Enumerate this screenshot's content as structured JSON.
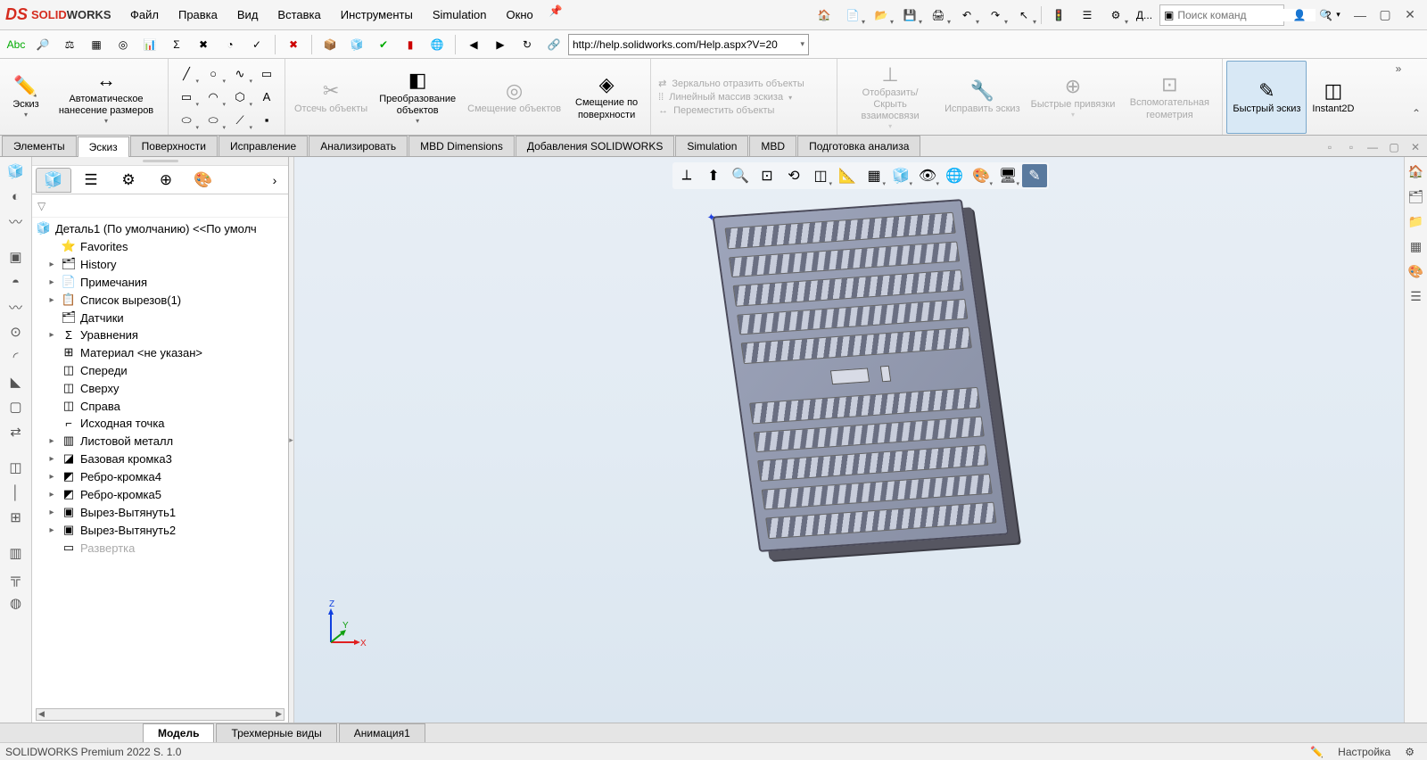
{
  "app": {
    "logo": "SOLIDWORKS"
  },
  "menu": {
    "items": [
      "Файл",
      "Правка",
      "Вид",
      "Вставка",
      "Инструменты",
      "Simulation",
      "Окно"
    ]
  },
  "search": {
    "placeholder": "Поиск команд"
  },
  "qat_last": "Д...",
  "toolbar2": {
    "url": "http://help.solidworks.com/Help.aspx?V=20"
  },
  "ribbon": {
    "sketch": "Эскиз",
    "smart_dim": "Автоматическое нанесение размеров",
    "trim": "Отсечь объекты",
    "convert": "Преобразование объектов",
    "offset": "Смещение объектов",
    "offset_surface": "Смещение по поверхности",
    "mirror": "Зеркально отразить объекты",
    "linear": "Линейный массив эскиза",
    "move": "Переместить объекты",
    "display": "Отобразить/Скрыть взаимосвязи",
    "repair": "Исправить эскиз",
    "quick_snaps": "Быстрые привязки",
    "construction_geom": "Вспомогательная геометрия",
    "rapid_sketch": "Быстрый эскиз",
    "instant2d": "Instant2D"
  },
  "cm_tabs": [
    "Элементы",
    "Эскиз",
    "Поверхности",
    "Исправление",
    "Анализировать",
    "MBD Dimensions",
    "Добавления SOLIDWORKS",
    "Simulation",
    "MBD",
    "Подготовка анализа"
  ],
  "cm_active": 1,
  "tree": {
    "root": "Деталь1 (По умолчанию) <<По умолч",
    "items": [
      {
        "icon": "⭐",
        "label": "Favorites",
        "caret": ""
      },
      {
        "icon": "🗂",
        "label": "History",
        "caret": "▸"
      },
      {
        "icon": "📄",
        "label": "Примечания",
        "caret": "▸"
      },
      {
        "icon": "📋",
        "label": "Список вырезов(1)",
        "caret": "▸"
      },
      {
        "icon": "🗂",
        "label": "Датчики",
        "caret": ""
      },
      {
        "icon": "Σ",
        "label": "Уравнения",
        "caret": "▸"
      },
      {
        "icon": "⊞",
        "label": "Материал <не указан>",
        "caret": ""
      },
      {
        "icon": "◫",
        "label": "Спереди",
        "caret": ""
      },
      {
        "icon": "◫",
        "label": "Сверху",
        "caret": ""
      },
      {
        "icon": "◫",
        "label": "Справа",
        "caret": ""
      },
      {
        "icon": "⌐",
        "label": "Исходная точка",
        "caret": ""
      },
      {
        "icon": "▥",
        "label": "Листовой металл",
        "caret": "▸"
      },
      {
        "icon": "◪",
        "label": "Базовая кромка3",
        "caret": "▸"
      },
      {
        "icon": "◩",
        "label": "Ребро-кромка4",
        "caret": "▸"
      },
      {
        "icon": "◩",
        "label": "Ребро-кромка5",
        "caret": "▸"
      },
      {
        "icon": "▣",
        "label": "Вырез-Вытянуть1",
        "caret": "▸"
      },
      {
        "icon": "▣",
        "label": "Вырез-Вытянуть2",
        "caret": "▸"
      },
      {
        "icon": "▭",
        "label": "Развертка",
        "caret": "",
        "dim": true
      }
    ]
  },
  "triad": {
    "x": "X",
    "y": "Y",
    "z": "Z"
  },
  "bottom_tabs": [
    "Модель",
    "Трехмерные виды",
    "Анимация1"
  ],
  "bottom_active": 0,
  "status": {
    "left": "SOLIDWORKS Premium 2022 S. 1.0",
    "setting": "Настройка"
  }
}
